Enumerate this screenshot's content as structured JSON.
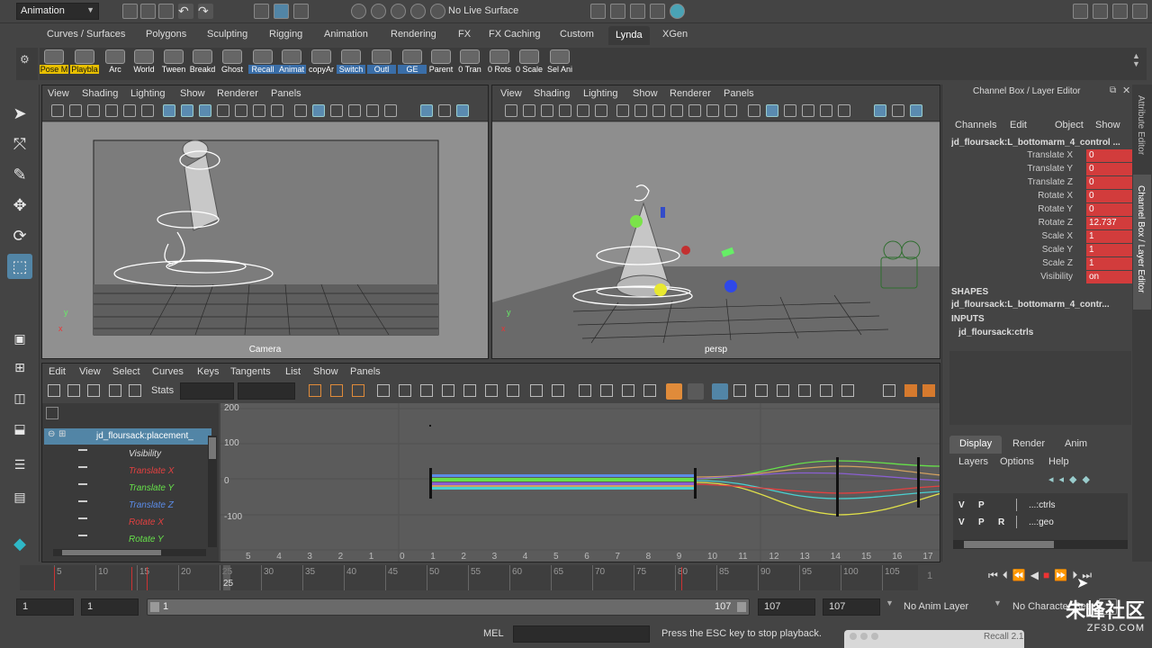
{
  "status_line": {
    "mode": "Animation",
    "live_surface": "No Live Surface"
  },
  "shelf_tabs": [
    "Curves / Surfaces",
    "Polygons",
    "Sculpting",
    "Rigging",
    "Animation",
    "Rendering",
    "FX",
    "FX Caching",
    "Custom",
    "Lynda",
    "XGen"
  ],
  "shelf_active_tab": "Lynda",
  "shelf_buttons": [
    {
      "label": "Pose M",
      "style": "hl"
    },
    {
      "label": "Playbla",
      "style": "hl"
    },
    {
      "label": "Arc",
      "style": ""
    },
    {
      "label": "World",
      "style": ""
    },
    {
      "label": "Tween",
      "style": ""
    },
    {
      "label": "Breakd",
      "style": ""
    },
    {
      "label": "Ghost",
      "style": ""
    },
    {
      "label": "Recall",
      "style": "bl"
    },
    {
      "label": "Animat",
      "style": "bl"
    },
    {
      "label": "copyAr",
      "style": ""
    },
    {
      "label": "Switch",
      "style": "bl"
    },
    {
      "label": "Outl",
      "style": "bl"
    },
    {
      "label": "GE",
      "style": "bl"
    },
    {
      "label": "Parent",
      "style": ""
    },
    {
      "label": "0 Tran",
      "style": ""
    },
    {
      "label": "0 Rots",
      "style": ""
    },
    {
      "label": "0 Scale",
      "style": ""
    },
    {
      "label": "Sel Ani",
      "style": ""
    }
  ],
  "viewport_menus": [
    "View",
    "Shading",
    "Lighting",
    "Show",
    "Renderer",
    "Panels"
  ],
  "viewport_left": {
    "camera_label": "Camera"
  },
  "viewport_right": {
    "camera_label": "persp"
  },
  "graph_editor": {
    "menus": [
      "Edit",
      "View",
      "Select",
      "Curves",
      "Keys",
      "Tangents",
      "List",
      "Show",
      "Panels"
    ],
    "stats_label": "Stats",
    "outliner_root": "jd_floursack:placement_",
    "channels": [
      {
        "name": "Visibility",
        "color": "#dddddd"
      },
      {
        "name": "Translate X",
        "color": "#e34040"
      },
      {
        "name": "Translate Y",
        "color": "#66e04a"
      },
      {
        "name": "Translate Z",
        "color": "#5b8ce8"
      },
      {
        "name": "Rotate X",
        "color": "#e34040"
      },
      {
        "name": "Rotate Y",
        "color": "#66e04a"
      }
    ],
    "y_ticks": [
      "200",
      "100",
      "0",
      "-100"
    ],
    "x_ticks": [
      "5",
      "4",
      "3",
      "2",
      "1",
      "0",
      "1",
      "2",
      "3",
      "4",
      "5",
      "6",
      "7",
      "8",
      "9",
      "10",
      "11",
      "12",
      "13",
      "14",
      "15",
      "16",
      "17"
    ]
  },
  "channel_box": {
    "title": "Channel Box / Layer Editor",
    "menus": [
      "Channels",
      "Edit",
      "Object",
      "Show"
    ],
    "object_name": "jd_floursack:L_bottomarm_4_control ...",
    "attributes": [
      {
        "label": "Translate X",
        "value": "0"
      },
      {
        "label": "Translate Y",
        "value": "0"
      },
      {
        "label": "Translate Z",
        "value": "0"
      },
      {
        "label": "Rotate X",
        "value": "0"
      },
      {
        "label": "Rotate Y",
        "value": "0"
      },
      {
        "label": "Rotate Z",
        "value": "12.737"
      },
      {
        "label": "Scale X",
        "value": "1"
      },
      {
        "label": "Scale Y",
        "value": "1"
      },
      {
        "label": "Scale Z",
        "value": "1"
      },
      {
        "label": "Visibility",
        "value": "on"
      }
    ],
    "shapes_header": "SHAPES",
    "shapes_item": "jd_floursack:L_bottomarm_4_contr...",
    "inputs_header": "INPUTS",
    "inputs_item": "jd_floursack:ctrls",
    "layer_tabs": [
      "Display",
      "Render",
      "Anim"
    ],
    "layer_menus": [
      "Layers",
      "Options",
      "Help"
    ],
    "layers": [
      {
        "v": "V",
        "p": "P",
        "r": "",
        "name": "...:ctrls"
      },
      {
        "v": "V",
        "p": "P",
        "r": "R",
        "name": "...:geo"
      }
    ],
    "side_tabs": [
      "Attribute Editor",
      "Channel Box / Layer Editor"
    ]
  },
  "time_slider": {
    "ticks": [
      "5",
      "10",
      "15",
      "20",
      "25",
      "30",
      "35",
      "40",
      "45",
      "50",
      "55",
      "60",
      "65",
      "70",
      "75",
      "80",
      "85",
      "90",
      "95",
      "100",
      "105"
    ],
    "current_frame": "25",
    "current_field": "1"
  },
  "range_slider": {
    "start": "1",
    "playback_start": "1",
    "range_start_label": "1",
    "range_end_label": "107",
    "playback_end": "107",
    "end": "107",
    "anim_layer": "No Anim Layer",
    "character_set": "No Character Set"
  },
  "command_line": {
    "label": "MEL",
    "help": "Press the ESC key to stop playback.",
    "popup": "Recall 2.1"
  },
  "watermark": {
    "main": "朱峰社区",
    "sub": "ZF3D.COM"
  }
}
